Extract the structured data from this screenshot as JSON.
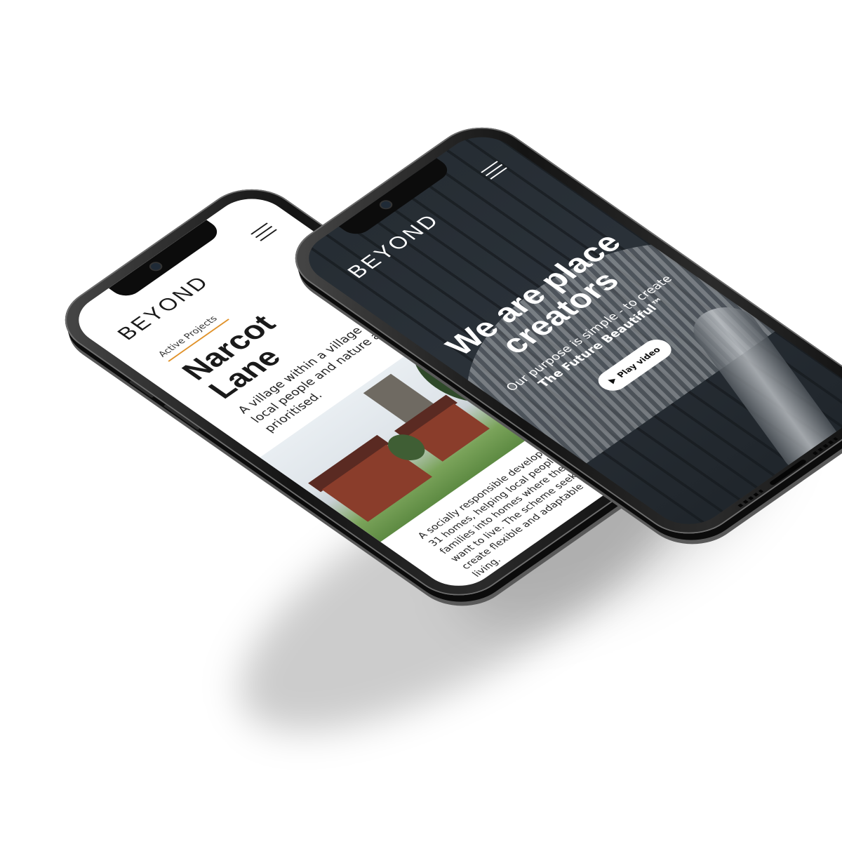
{
  "left_phone": {
    "logo": "BEYOND",
    "kicker": "Active Projects",
    "title": "Narcot Lane",
    "subtitle": "A village within a village where local people and nature are prioritised.",
    "body": "A socially responsible development of 31 homes, helping local people and families into homes where they really want to live. The scheme seeks to create flexible and adaptable modern living.",
    "menu_icon": "hamburger-menu-icon",
    "accent": "#e0922a"
  },
  "right_phone": {
    "logo": "BEYOND",
    "title": "We are place creators",
    "subtitle": "Our purpose is simple - to create",
    "tagline": "The Future Beautiful™",
    "play_label": "Play video",
    "menu_icon": "hamburger-menu-icon",
    "play_icon": "play-icon"
  }
}
